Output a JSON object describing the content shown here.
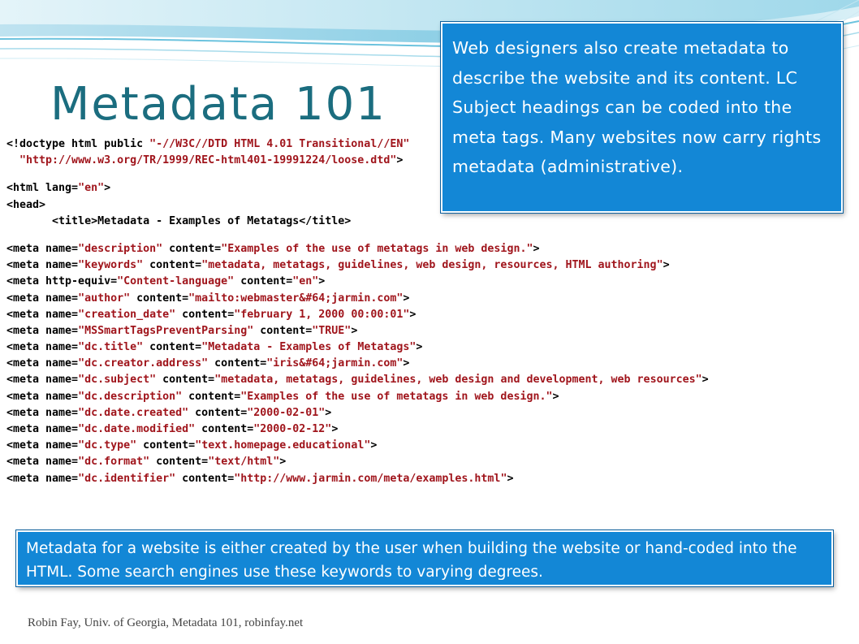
{
  "slide": {
    "title": "Metadata 101",
    "accent_color": "#1387d6",
    "title_color": "#1b6d7f"
  },
  "code": {
    "doctype_line1": "<!doctype html public \"-//W3C//DTD HTML 4.01 Transitional//EN\"",
    "doctype_line2": "  \"http://www.w3.org/TR/1999/REC-html401-19991224/loose.dtd\">",
    "html_open": "<html lang=\"en\">",
    "head_open": "<head>",
    "title_line": "       <title>Metadata - Examples of Metatags</title>",
    "meta_lines": [
      "<meta name=\"description\" content=\"Examples of the use of metatags in web design.\">",
      "<meta name=\"keywords\" content=\"metadata, metatags, guidelines, web design, resources, HTML authoring\">",
      "<meta http-equiv=\"Content-language\" content=\"en\">",
      "<meta name=\"author\" content=\"mailto:webmaster&#64;jarmin.com\">",
      "<meta name=\"creation_date\" content=\"february 1, 2000 00:00:01\">",
      "<meta name=\"MSSmartTagsPreventParsing\" content=\"TRUE\">",
      "<meta name=\"dc.title\" content=\"Metadata - Examples of Metatags\">",
      "<meta name=\"dc.creator.address\" content=\"iris&#64;jarmin.com\">",
      "<meta name=\"dc.subject\" content=\"metadata, metatags, guidelines, web design and development, web resources\">",
      "<meta name=\"dc.description\" content=\"Examples of the use of metatags in web design.\">",
      "<meta name=\"dc.date.created\" content=\"2000-02-01\">",
      "<meta name=\"dc.date.modified\" content=\"2000-02-12\">",
      "<meta name=\"dc.type\" content=\"text.homepage.educational\">",
      "<meta name=\"dc.format\" content=\"text/html\">",
      "<meta name=\"dc.identifier\" content=\"http://www.jarmin.com/meta/examples.html\">"
    ]
  },
  "callouts": {
    "top": "Web designers also create metadata to describe the website and its content.  LC Subject headings can be coded into the meta tags.  Many websites now carry rights metadata (administrative).",
    "bottom": "Metadata for a website is either created by the user when building the website or hand-coded into the HTML. Some search engines use these keywords to varying degrees."
  },
  "footer": {
    "credit": "Robin Fay, Univ. of Georgia, Metadata 101, robinfay.net"
  }
}
